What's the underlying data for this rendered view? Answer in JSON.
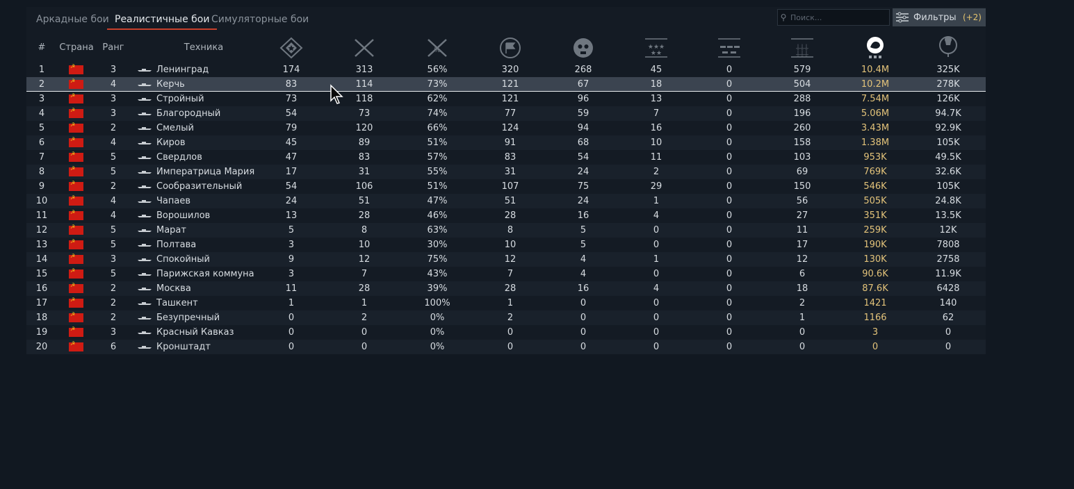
{
  "tabs": [
    {
      "label": "Аркадные бои"
    },
    {
      "label": "Реалистичные бои"
    },
    {
      "label": "Симуляторные бои"
    }
  ],
  "search": {
    "placeholder": "Поиск..."
  },
  "filters": {
    "label": "Фильтры",
    "count": "(+2)"
  },
  "columns": {
    "num": "#",
    "country": "Страна",
    "rank": "Ранг",
    "vehicle": "Техника"
  },
  "stat_icons": [
    "battles-icon",
    "victories-icon",
    "win-rate-icon",
    "respawns-icon",
    "deaths-icon",
    "naval-kills-icon",
    "ground-kills-icon",
    "total-kills-icon",
    "silver-lions-icon",
    "research-points-icon"
  ],
  "colors": {
    "accent": "#c8402c",
    "gold": "#e3c37a",
    "flag": "#cf1b13"
  },
  "rows": [
    {
      "n": "1",
      "rank": "3",
      "name": "Ленинград",
      "s": [
        "174",
        "313",
        "56%",
        "320",
        "268",
        "45",
        "0",
        "579",
        "10.4M",
        "325K"
      ]
    },
    {
      "n": "2",
      "rank": "4",
      "name": "Керчь",
      "s": [
        "83",
        "114",
        "73%",
        "121",
        "67",
        "18",
        "0",
        "504",
        "10.2M",
        "278K"
      ]
    },
    {
      "n": "3",
      "rank": "3",
      "name": "Стройный",
      "s": [
        "73",
        "118",
        "62%",
        "121",
        "96",
        "13",
        "0",
        "288",
        "7.54M",
        "126K"
      ]
    },
    {
      "n": "4",
      "rank": "3",
      "name": "Благородный",
      "s": [
        "54",
        "73",
        "74%",
        "77",
        "59",
        "7",
        "0",
        "196",
        "5.06M",
        "94.7K"
      ]
    },
    {
      "n": "5",
      "rank": "2",
      "name": "Смелый",
      "s": [
        "79",
        "120",
        "66%",
        "124",
        "94",
        "16",
        "0",
        "260",
        "3.43M",
        "92.9K"
      ]
    },
    {
      "n": "6",
      "rank": "4",
      "name": "Киров",
      "s": [
        "45",
        "89",
        "51%",
        "91",
        "68",
        "10",
        "0",
        "158",
        "1.38M",
        "105K"
      ]
    },
    {
      "n": "7",
      "rank": "5",
      "name": "Свердлов",
      "s": [
        "47",
        "83",
        "57%",
        "83",
        "54",
        "11",
        "0",
        "103",
        "953K",
        "49.5K"
      ]
    },
    {
      "n": "8",
      "rank": "5",
      "name": "Императрица Мария",
      "s": [
        "17",
        "31",
        "55%",
        "31",
        "24",
        "2",
        "0",
        "69",
        "769K",
        "32.6K"
      ]
    },
    {
      "n": "9",
      "rank": "2",
      "name": "Сообразительный",
      "s": [
        "54",
        "106",
        "51%",
        "107",
        "75",
        "29",
        "0",
        "150",
        "546K",
        "105K"
      ]
    },
    {
      "n": "10",
      "rank": "4",
      "name": "Чапаев",
      "s": [
        "24",
        "51",
        "47%",
        "51",
        "24",
        "1",
        "0",
        "56",
        "505K",
        "24.8K"
      ]
    },
    {
      "n": "11",
      "rank": "4",
      "name": "Ворошилов",
      "s": [
        "13",
        "28",
        "46%",
        "28",
        "16",
        "4",
        "0",
        "27",
        "351K",
        "13.5K"
      ]
    },
    {
      "n": "12",
      "rank": "5",
      "name": "Марат",
      "s": [
        "5",
        "8",
        "63%",
        "8",
        "5",
        "0",
        "0",
        "11",
        "259K",
        "12K"
      ]
    },
    {
      "n": "13",
      "rank": "5",
      "name": "Полтава",
      "s": [
        "3",
        "10",
        "30%",
        "10",
        "5",
        "0",
        "0",
        "17",
        "190K",
        "7808"
      ]
    },
    {
      "n": "14",
      "rank": "3",
      "name": "Спокойный",
      "s": [
        "9",
        "12",
        "75%",
        "12",
        "4",
        "1",
        "0",
        "12",
        "130K",
        "2758"
      ]
    },
    {
      "n": "15",
      "rank": "5",
      "name": "Парижская коммуна",
      "s": [
        "3",
        "7",
        "43%",
        "7",
        "4",
        "0",
        "0",
        "6",
        "90.6K",
        "11.9K"
      ]
    },
    {
      "n": "16",
      "rank": "2",
      "name": "Москва",
      "s": [
        "11",
        "28",
        "39%",
        "28",
        "16",
        "4",
        "0",
        "18",
        "87.6K",
        "6428"
      ]
    },
    {
      "n": "17",
      "rank": "2",
      "name": "Ташкент",
      "s": [
        "1",
        "1",
        "100%",
        "1",
        "0",
        "0",
        "0",
        "2",
        "1421",
        "140"
      ]
    },
    {
      "n": "18",
      "rank": "2",
      "name": "Безупречный",
      "s": [
        "0",
        "2",
        "0%",
        "2",
        "0",
        "0",
        "0",
        "1",
        "1166",
        "62"
      ]
    },
    {
      "n": "19",
      "rank": "3",
      "name": "Красный Кавказ",
      "s": [
        "0",
        "0",
        "0%",
        "0",
        "0",
        "0",
        "0",
        "0",
        "3",
        "0"
      ]
    },
    {
      "n": "20",
      "rank": "6",
      "name": "Кронштадт",
      "s": [
        "0",
        "0",
        "0%",
        "0",
        "0",
        "0",
        "0",
        "0",
        "0",
        "0"
      ]
    }
  ],
  "selected_row": 1
}
